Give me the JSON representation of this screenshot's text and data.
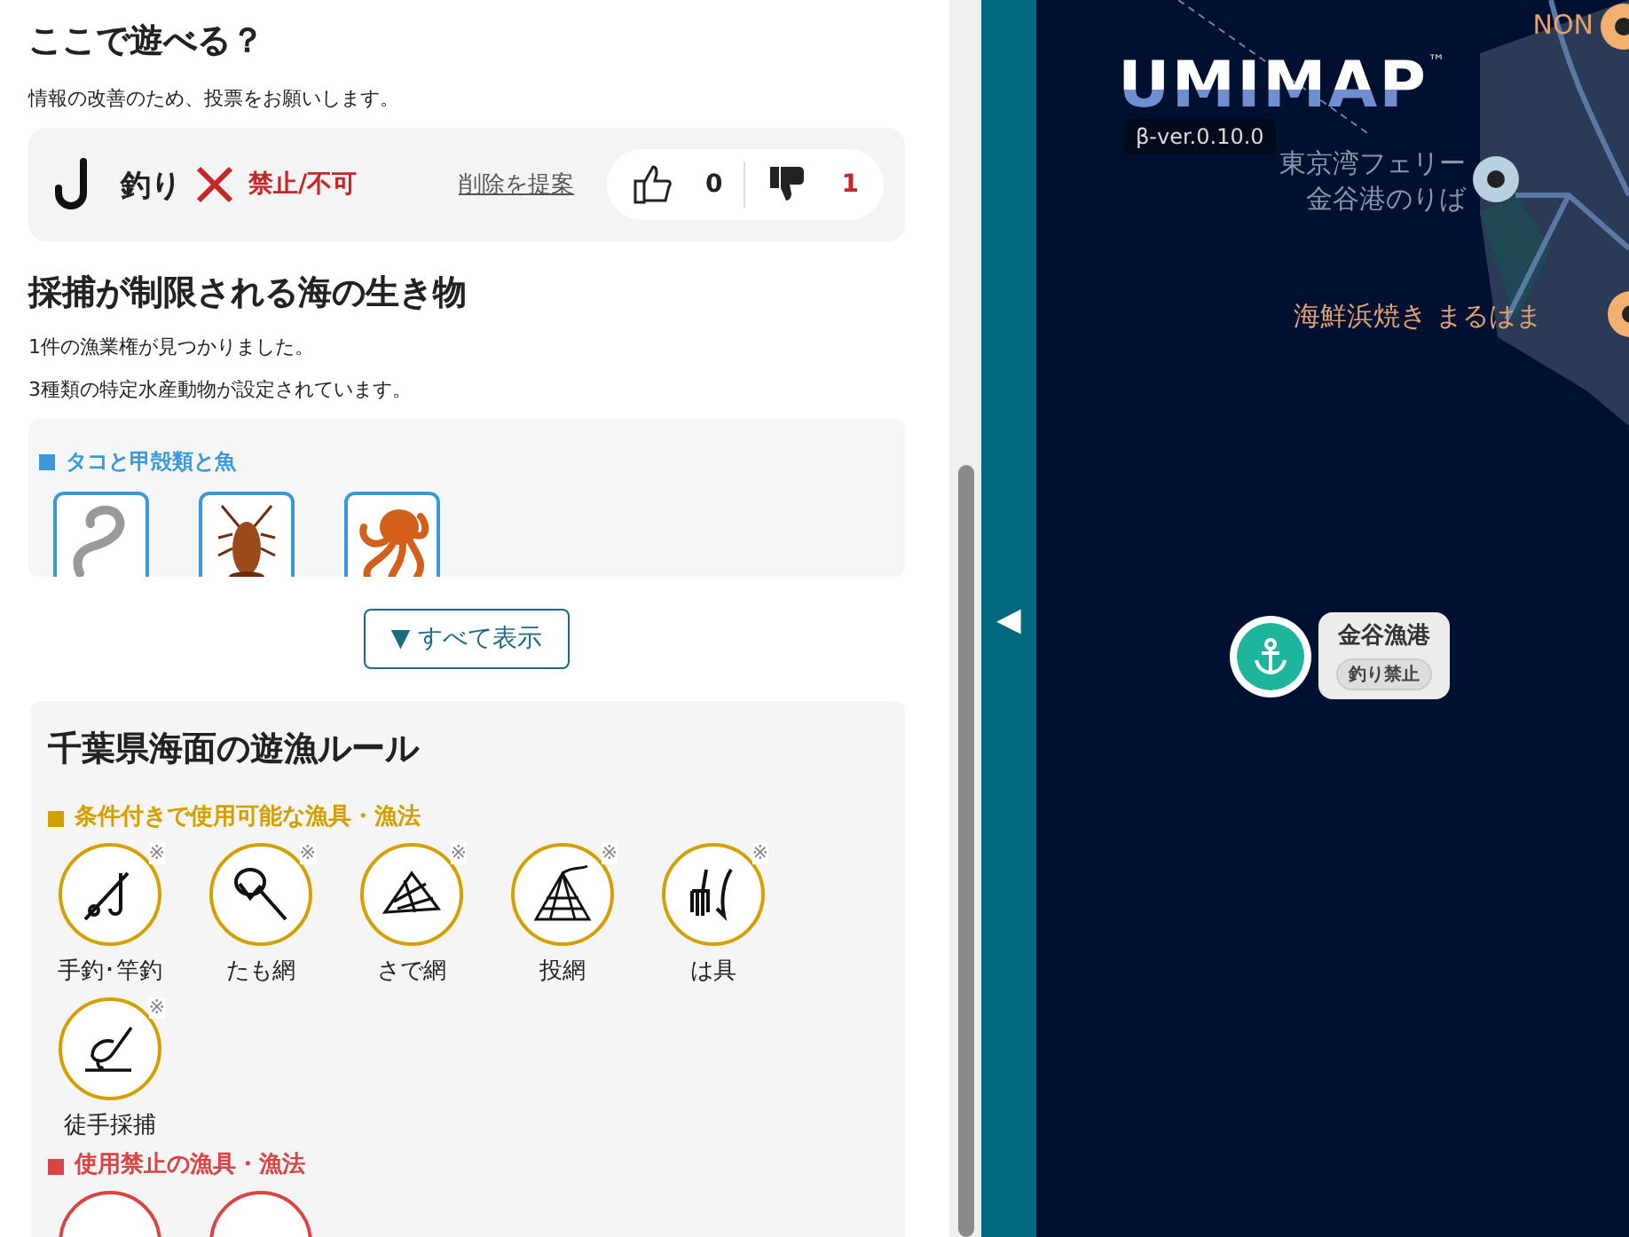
{
  "play": {
    "title": "ここで遊べる？",
    "subtitle": "情報の改善のため、投票をお願いします。",
    "activity": {
      "name": "釣り",
      "status": "禁止/不可",
      "suggest_link": "削除を提案",
      "up_count": "0",
      "down_count": "1"
    }
  },
  "species": {
    "title": "採捕が制限される海の生き物",
    "notes": [
      "1件の漁業権が見つかりました。",
      "3種類の特定水産動物が設定されています。"
    ],
    "group_label": "タコと甲殻類と魚",
    "tiles": [
      {
        "kind": "eel"
      },
      {
        "kind": "lobster"
      },
      {
        "kind": "octopus"
      }
    ],
    "show_all_button": "▼ すべて表示"
  },
  "rules": {
    "title": "千葉県海面の遊漁ルール",
    "sections": [
      {
        "kind": "conditional",
        "label": "条件付きで使用可能な漁具・漁法",
        "items": [
          {
            "kind": "conditional",
            "name": "手釣･竿釣",
            "mark": "※"
          },
          {
            "kind": "conditional",
            "name": "たも網",
            "mark": "※"
          },
          {
            "kind": "conditional",
            "name": "さで網",
            "mark": "※"
          },
          {
            "kind": "conditional",
            "name": "投網",
            "mark": "※"
          },
          {
            "kind": "conditional",
            "name": "は具",
            "mark": "※"
          },
          {
            "kind": "conditional",
            "name": "徒手採捕",
            "mark": "※"
          }
        ]
      },
      {
        "kind": "prohibited",
        "label": "使用禁止の漁具・漁法",
        "items": [
          {
            "kind": "prohibited"
          },
          {
            "kind": "prohibited"
          }
        ]
      }
    ]
  },
  "map": {
    "toggle": "◀",
    "logo": "UMIMAP",
    "trademark": "™",
    "version": "β-ver.0.10.0",
    "places": [
      {
        "kind": "poi",
        "lines": [
          "NON"
        ]
      },
      {
        "kind": "ferry",
        "lines": [
          "東京湾フェリー",
          "金谷港のりば"
        ]
      },
      {
        "kind": "food",
        "lines": [
          "海鮮浜焼き まるはま"
        ]
      }
    ],
    "port": {
      "name": "金谷漁港",
      "tag": "釣り禁止"
    }
  }
}
